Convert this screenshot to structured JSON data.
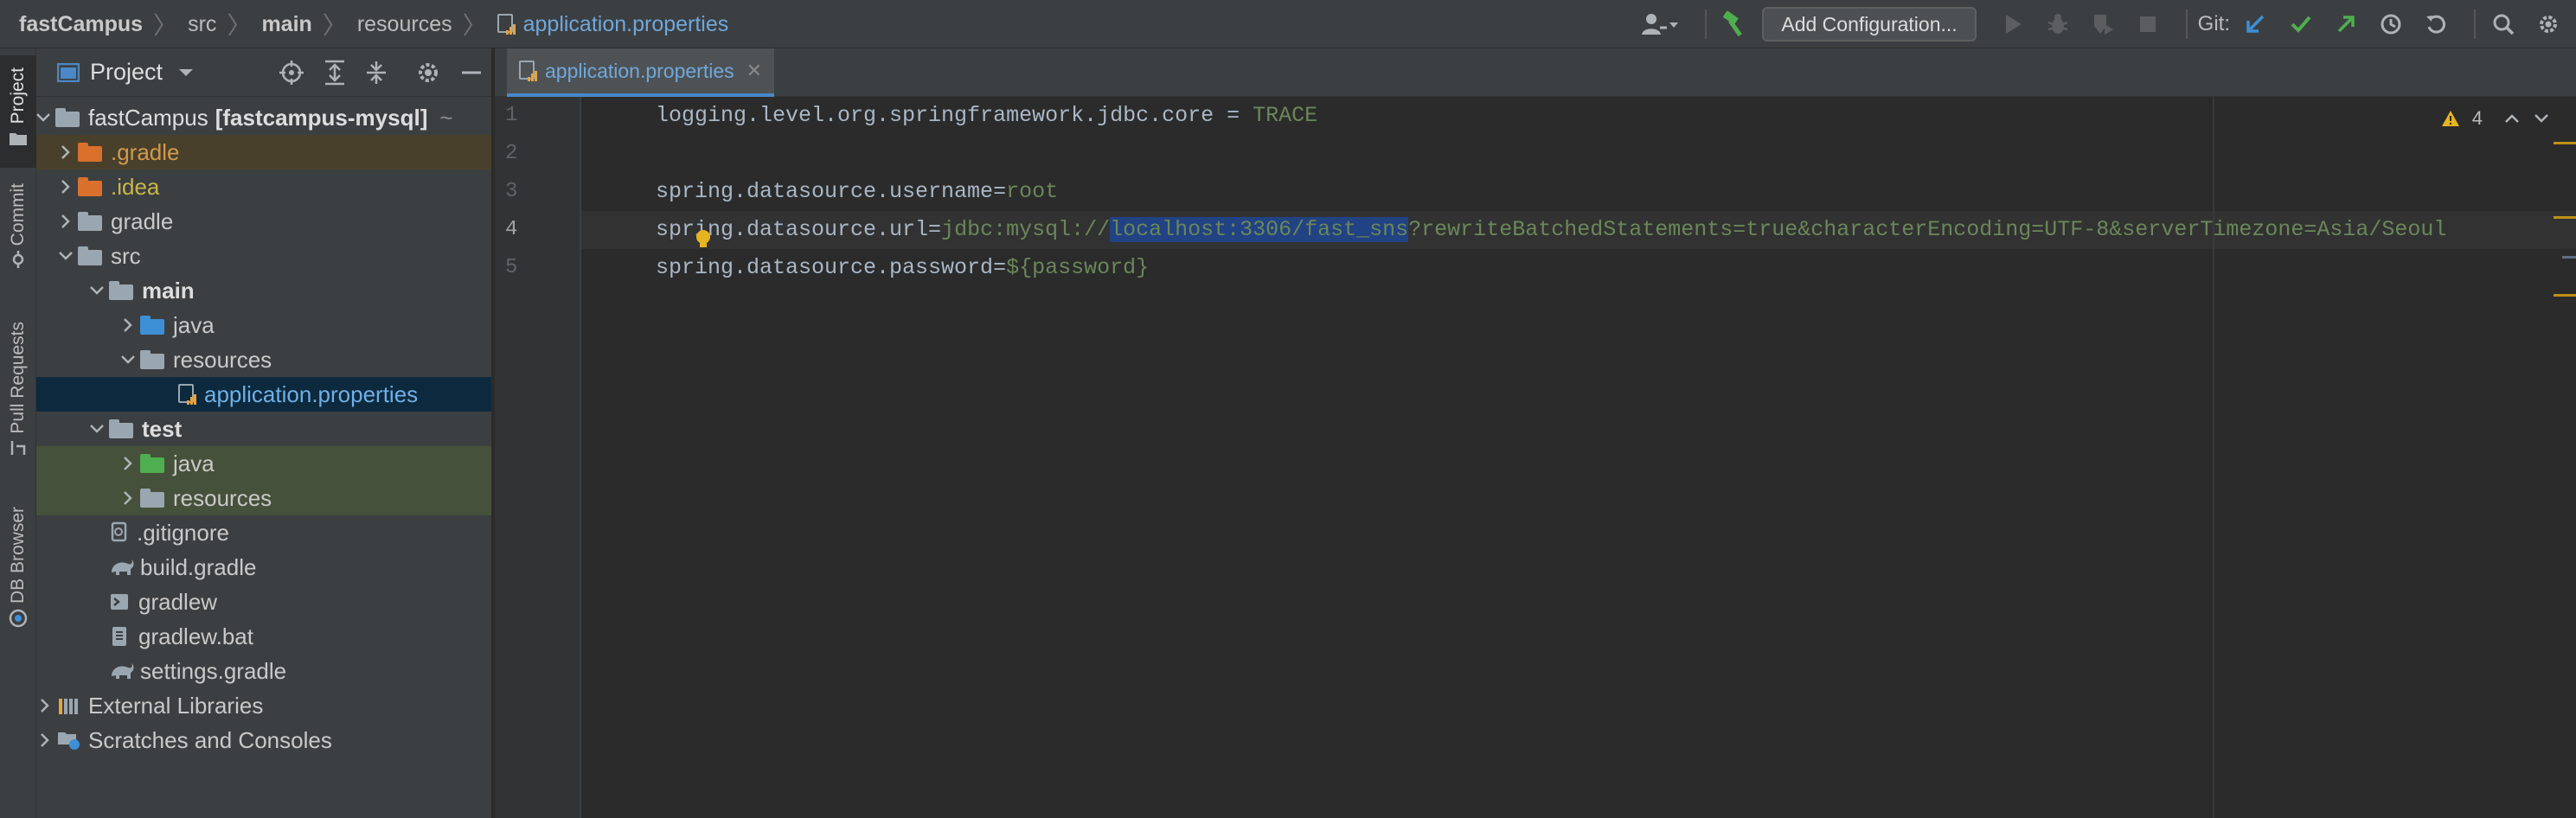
{
  "breadcrumbs": {
    "project": "fastCampus",
    "src": "src",
    "main": "main",
    "resources": "resources",
    "file": "application.properties"
  },
  "toolbar": {
    "add_configuration": "Add Configuration...",
    "git_label": "Git:"
  },
  "tool_stripe": {
    "project": "Project",
    "commit": "Commit",
    "pull_requests": "Pull Requests",
    "db_browser": "DB Browser"
  },
  "project_panel": {
    "title": "Project",
    "tree": [
      {
        "label": "fastCampus",
        "suffix": "[fastcampus-mysql]",
        "path": "~"
      },
      {
        "label": ".gradle"
      },
      {
        "label": ".idea"
      },
      {
        "label": "gradle"
      },
      {
        "label": "src"
      },
      {
        "label": "main"
      },
      {
        "label": "java"
      },
      {
        "label": "resources"
      },
      {
        "label": "application.properties"
      },
      {
        "label": "test"
      },
      {
        "label": "java"
      },
      {
        "label": "resources"
      },
      {
        "label": ".gitignore"
      },
      {
        "label": "build.gradle"
      },
      {
        "label": "gradlew"
      },
      {
        "label": "gradlew.bat"
      },
      {
        "label": "settings.gradle"
      },
      {
        "label": "External Libraries"
      },
      {
        "label": "Scratches and Consoles"
      }
    ]
  },
  "editor": {
    "tab_label": "application.properties",
    "warning_count": "4",
    "lines": [
      {
        "num": "1",
        "key": "logging.level.org.springframework.jdbc.core = ",
        "value": "TRACE"
      },
      {
        "num": "2",
        "key": "",
        "value": ""
      },
      {
        "num": "3",
        "key": "spring.datasource.username=",
        "value": "root"
      },
      {
        "num": "4",
        "key": "spring.datasource.url=",
        "value_pre": "jdbc:mysql://",
        "value_sel": "localhost:3306/fast_sns",
        "value_post": "?rewriteBatchedStatements=true&characterEncoding=UTF-8&serverTimezone=Asia/Seoul"
      },
      {
        "num": "5",
        "key": "spring.datasource.password=",
        "value": "${password}"
      }
    ]
  },
  "colors": {
    "accent": "#4a88c7",
    "string_value": "#6a8759",
    "key": "#a9b7c6",
    "selection": "#214283",
    "git_blue": "#3d8fd6",
    "git_green": "#4fae4f"
  }
}
